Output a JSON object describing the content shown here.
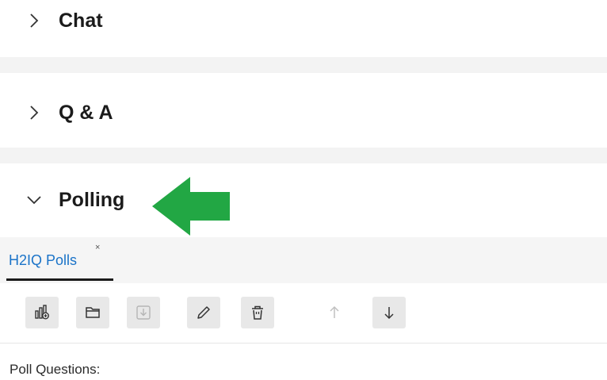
{
  "sections": {
    "chat": {
      "title": "Chat",
      "expanded": false
    },
    "qa": {
      "title": "Q & A",
      "expanded": false
    },
    "polling": {
      "title": "Polling",
      "expanded": true
    }
  },
  "polling": {
    "tab_label": "H2IQ Polls",
    "tab_close": "×",
    "toolbar": [
      {
        "name": "new-poll-button",
        "icon": "poll-chart-icon",
        "enabled": true
      },
      {
        "name": "open-folder-button",
        "icon": "folder-icon",
        "enabled": true
      },
      {
        "name": "import-button",
        "icon": "download-icon",
        "enabled": false
      },
      {
        "name": "edit-button",
        "icon": "pencil-icon",
        "enabled": true
      },
      {
        "name": "delete-button",
        "icon": "trash-icon",
        "enabled": true
      },
      {
        "name": "move-up-button",
        "icon": "arrow-up-icon",
        "enabled": false
      },
      {
        "name": "move-down-button",
        "icon": "arrow-down-icon",
        "enabled": true
      }
    ],
    "questions_label": "Poll Questions:"
  },
  "colors": {
    "accent_blue": "#1a73c8",
    "annotation_arrow": "#22a744"
  }
}
